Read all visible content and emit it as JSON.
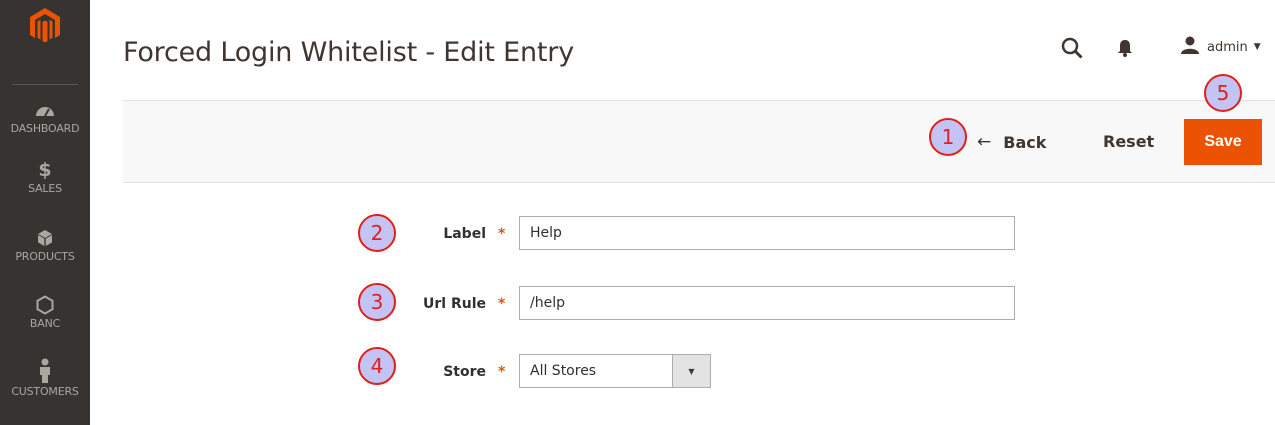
{
  "page": {
    "title": "Forced Login Whitelist - Edit Entry"
  },
  "header": {
    "user_name": "admin"
  },
  "sidebar": {
    "items": [
      {
        "label": "DASHBOARD",
        "icon": "dashboard-icon"
      },
      {
        "label": "SALES",
        "icon": "dollar-icon"
      },
      {
        "label": "PRODUCTS",
        "icon": "box-icon"
      },
      {
        "label": "BANC",
        "icon": "hexagon-icon"
      },
      {
        "label": "CUSTOMERS",
        "icon": "person-icon"
      }
    ]
  },
  "actions": {
    "back_label": "Back",
    "back_arrow": "←",
    "reset_label": "Reset",
    "save_label": "Save"
  },
  "form": {
    "label_field": {
      "label": "Label",
      "required": "*",
      "value": "Help"
    },
    "url_rule_field": {
      "label": "Url Rule",
      "required": "*",
      "value": "/help"
    },
    "store_field": {
      "label": "Store",
      "required": "*",
      "value": "All Stores"
    }
  },
  "annotations": {
    "badge_1": "1",
    "badge_2": "2",
    "badge_3": "3",
    "badge_4": "4",
    "badge_5": "5"
  },
  "colors": {
    "sidebar_bg": "#373330",
    "accent": "#eb5202",
    "badge_fill": "#c3c3f4",
    "badge_border": "#e0211b"
  }
}
